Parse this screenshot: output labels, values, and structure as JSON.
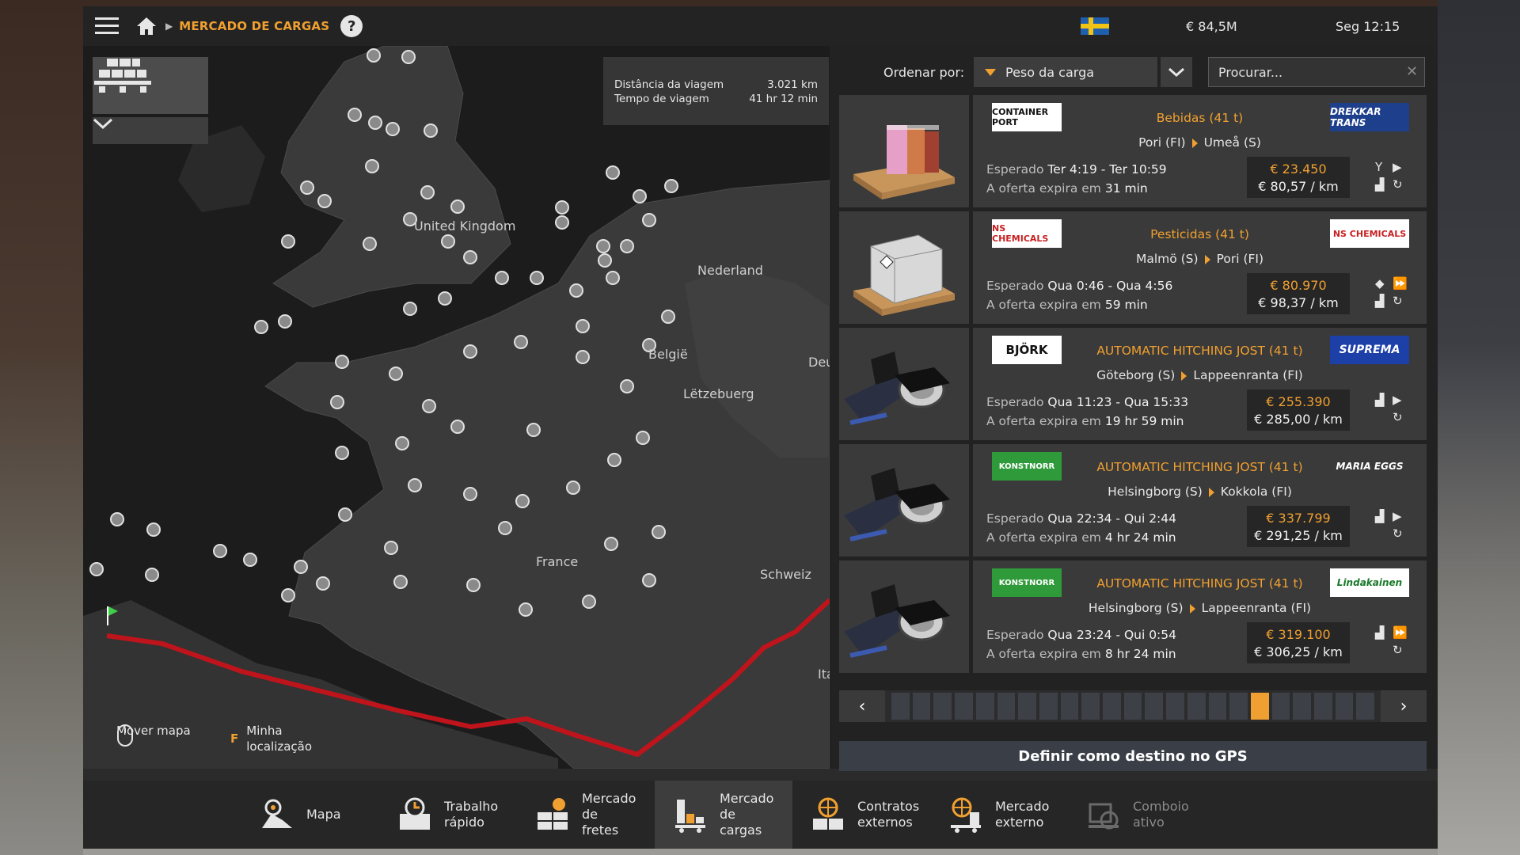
{
  "header": {
    "breadcrumb": "MERCADO DE CARGAS",
    "help": "?",
    "money": "€ 84,5M",
    "clock": "Seg 12:15"
  },
  "map": {
    "labels": {
      "uk": "United Kingdom",
      "nederland": "Nederland",
      "belgie": "België",
      "luxemburg": "Lëtzebuerg",
      "deutschland": "Deu",
      "france": "France",
      "schweiz": "Schweiz",
      "italia": "Ita"
    },
    "trip": {
      "distance_label": "Distância da viagem",
      "distance_value": "3.021 km",
      "time_label": "Tempo de viagem",
      "time_value": "41 hr 12 min"
    },
    "hint_move": "Mover mapa",
    "hint_key": "F",
    "hint_location_1": "Minha",
    "hint_location_2": "localização"
  },
  "sort": {
    "label": "Ordenar por:",
    "value": "Peso da carga",
    "search_placeholder": "Procurar..."
  },
  "offers": [
    {
      "logo_left": "CONTAINER PORT",
      "logo_right": "DREKKAR TRANS",
      "cargo": "Bebidas (41 t)",
      "from": "Pori (FI)",
      "to": "Umeå (S)",
      "expected_label": "Esperado",
      "expected": "Ter 4:19 - Ter 10:59",
      "expire_label": "A oferta expira em",
      "expire": "31 min",
      "price": "€ 23.450",
      "per_km": "€ 80,57 / km"
    },
    {
      "logo_left": "NS CHEMICALS",
      "logo_right": "NS CHEMICALS",
      "cargo": "Pesticidas (41 t)",
      "from": "Malmö (S)",
      "to": "Pori (FI)",
      "expected_label": "Esperado",
      "expected": "Qua 0:46 - Qua 4:56",
      "expire_label": "A oferta expira em",
      "expire": "59 min",
      "price": "€ 80.970",
      "per_km": "€ 98,37 / km"
    },
    {
      "logo_left": "BJÖRK",
      "logo_right": "SUPREMA",
      "cargo": "AUTOMATIC HITCHING JOST (41 t)",
      "from": "Göteborg (S)",
      "to": "Lappeenranta (FI)",
      "expected_label": "Esperado",
      "expected": "Qua 11:23 - Qua 15:33",
      "expire_label": "A oferta expira em",
      "expire": "19 hr 59 min",
      "price": "€ 255.390",
      "per_km": "€ 285,00 / km"
    },
    {
      "logo_left": "KONSTNORR",
      "logo_right": "MARIA EGGS",
      "cargo": "AUTOMATIC HITCHING JOST (41 t)",
      "from": "Helsingborg (S)",
      "to": "Kokkola (FI)",
      "expected_label": "Esperado",
      "expected": "Qua 22:34 - Qui 2:44",
      "expire_label": "A oferta expira em",
      "expire": "4 hr 24 min",
      "price": "€ 337.799",
      "per_km": "€ 291,25 / km"
    },
    {
      "logo_left": "KONSTNORR",
      "logo_right": "Lindakainen",
      "cargo": "AUTOMATIC HITCHING JOST (41 t)",
      "from": "Helsingborg (S)",
      "to": "Lappeenranta (FI)",
      "expected_label": "Esperado",
      "expected": "Qua 23:24 - Qui 0:54",
      "expire_label": "A oferta expira em",
      "expire": "8 hr 24 min",
      "price": "€ 319.100",
      "per_km": "€ 306,25 / km"
    }
  ],
  "pager": {
    "prev": "‹",
    "next": "›",
    "segments": 23,
    "active_segment": 18
  },
  "gps_button": "Definir como destino no GPS",
  "nav": [
    {
      "l1": "Mapa",
      "l2": ""
    },
    {
      "l1": "Trabalho",
      "l2": "rápido"
    },
    {
      "l1": "Mercado de",
      "l2": "fretes"
    },
    {
      "l1": "Mercado de",
      "l2": "cargas"
    },
    {
      "l1": "Contratos",
      "l2": "externos"
    },
    {
      "l1": "Mercado",
      "l2": "externo"
    },
    {
      "l1": "Comboio",
      "l2": "ativo"
    }
  ],
  "colors": {
    "accent": "#f0a030",
    "route": "#c0141c"
  }
}
